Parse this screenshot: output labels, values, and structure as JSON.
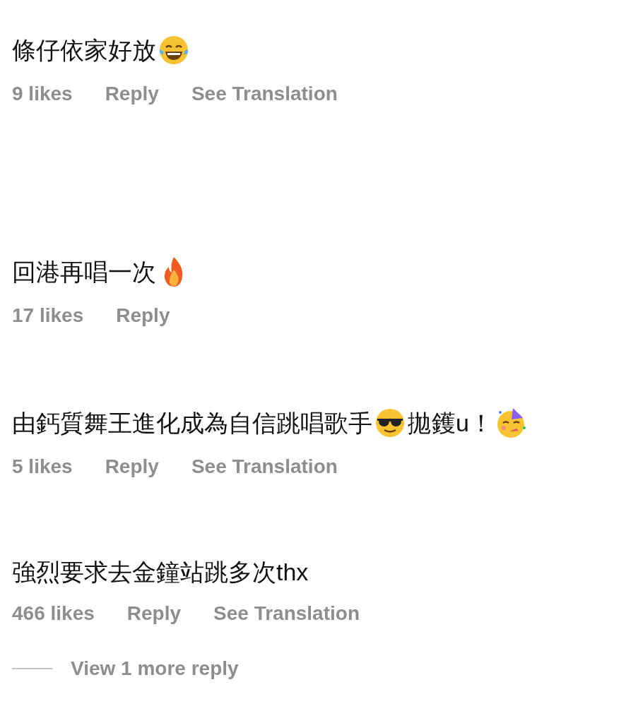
{
  "comments": [
    {
      "parts": [
        {
          "kind": "text",
          "text": "條仔依家好放"
        },
        {
          "kind": "laughing"
        }
      ],
      "actions": [
        "9 likes",
        "Reply",
        "See Translation"
      ]
    },
    {
      "parts": [
        {
          "kind": "text",
          "text": "回港再唱一次"
        },
        {
          "kind": "fire"
        }
      ],
      "actions": [
        "17 likes",
        "Reply"
      ]
    },
    {
      "parts": [
        {
          "kind": "text",
          "text": "由鈣質舞王進化成為自信跳唱歌手"
        },
        {
          "kind": "cool"
        },
        {
          "kind": "text",
          "text": "拋鑊u！"
        },
        {
          "kind": "party"
        }
      ],
      "actions": [
        "5 likes",
        "Reply",
        "See Translation"
      ]
    },
    {
      "parts": [
        {
          "kind": "text",
          "text": "強烈要求去金鐘站跳多次thx"
        }
      ],
      "actions": [
        "466 likes",
        "Reply",
        "See Translation"
      ]
    }
  ],
  "view_replies": {
    "label": "View 1 more reply"
  }
}
